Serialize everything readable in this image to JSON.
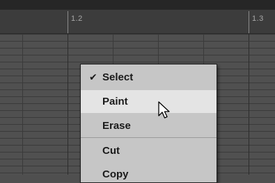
{
  "ruler": {
    "markers": [
      "1.2",
      "1.3"
    ]
  },
  "context_menu": {
    "items": [
      {
        "label": "Select",
        "checked": true
      },
      {
        "label": "Paint",
        "hovered": true
      },
      {
        "label": "Erase"
      },
      {
        "label": "Cut"
      },
      {
        "label": "Copy"
      }
    ]
  },
  "icons": {
    "check": "check-icon",
    "cursor": "pointer-cursor-icon"
  }
}
